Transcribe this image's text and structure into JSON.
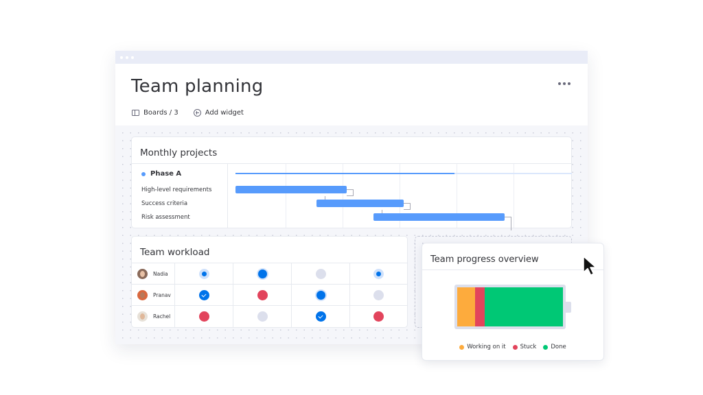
{
  "app": {
    "title": "Team planning",
    "more_menu_icon": "more-horizontal-icon"
  },
  "toolbar": {
    "boards_label": "Boards / 3",
    "boards_icon": "board-icon",
    "add_widget_label": "Add widget",
    "add_widget_icon": "plus-circle-icon"
  },
  "monthly_projects": {
    "title": "Monthly projects",
    "phase": {
      "label": "Phase A",
      "color": "#579bfc",
      "progress": 0.65
    },
    "tasks": [
      {
        "label": "High-level requirements",
        "start": 0.0,
        "end": 0.33
      },
      {
        "label": "Success criteria",
        "start": 0.24,
        "end": 0.5
      },
      {
        "label": "Risk assessment",
        "start": 0.41,
        "end": 0.8
      }
    ],
    "timeline_columns": 6,
    "bar_color": "#579bfc"
  },
  "team_workload": {
    "title": "Team workload",
    "rows": [
      {
        "name": "Nadia",
        "statuses": [
          "working-light",
          "working",
          "empty",
          "working-light"
        ]
      },
      {
        "name": "Pranav",
        "statuses": [
          "done",
          "stuck",
          "working",
          "empty"
        ]
      },
      {
        "name": "Rachel",
        "statuses": [
          "stuck",
          "empty",
          "done",
          "stuck"
        ]
      }
    ]
  },
  "team_progress": {
    "title": "Team progress overview",
    "segments": [
      {
        "label": "Working on it",
        "value": 17,
        "color": "#fdab3d"
      },
      {
        "label": "Stuck",
        "value": 9,
        "color": "#e2445c"
      },
      {
        "label": "Done",
        "value": 74,
        "color": "#00c875"
      }
    ]
  },
  "colors": {
    "primary": "#0073ea",
    "stuck": "#e2445c",
    "working": "#fdab3d",
    "done": "#00c875",
    "empty": "#dcdfec"
  }
}
